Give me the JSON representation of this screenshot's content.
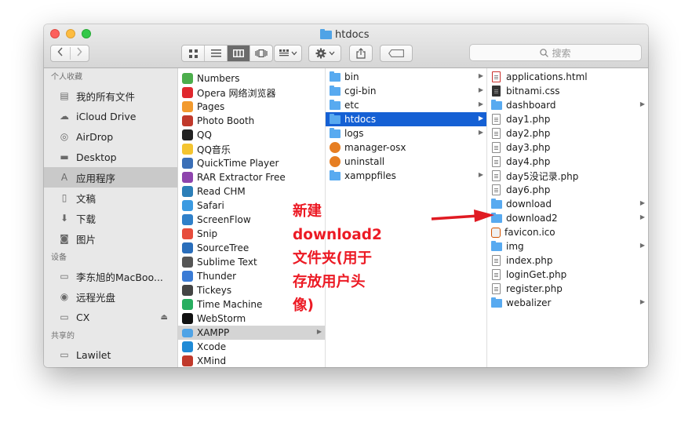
{
  "window": {
    "title": "htdocs"
  },
  "toolbar": {
    "back_icon": "chevron-left-icon",
    "forward_icon": "chevron-right-icon",
    "view_modes": [
      "icon-view",
      "list-view",
      "column-view",
      "cover-flow-view"
    ],
    "active_view": "column-view",
    "search_placeholder": "搜索"
  },
  "sidebar": {
    "sections": [
      {
        "label": "个人收藏",
        "items": [
          {
            "label": "我的所有文件",
            "icon": "all-files-icon"
          },
          {
            "label": "iCloud Drive",
            "icon": "cloud-icon"
          },
          {
            "label": "AirDrop",
            "icon": "airdrop-icon"
          },
          {
            "label": "Desktop",
            "icon": "desktop-icon"
          },
          {
            "label": "应用程序",
            "icon": "applications-icon",
            "selected": true
          },
          {
            "label": "文稿",
            "icon": "documents-icon"
          },
          {
            "label": "下载",
            "icon": "download-icon"
          },
          {
            "label": "图片",
            "icon": "pictures-icon"
          }
        ]
      },
      {
        "label": "设备",
        "items": [
          {
            "label": "李东旭的MacBoo...",
            "icon": "laptop-icon"
          },
          {
            "label": "远程光盘",
            "icon": "disc-icon"
          },
          {
            "label": "CX",
            "icon": "drive-icon",
            "eject": true
          }
        ]
      },
      {
        "label": "共享的",
        "items": [
          {
            "label": "Lawilet",
            "icon": "network-computer-icon"
          }
        ]
      }
    ]
  },
  "columns": {
    "apps": [
      {
        "name": "Numbers",
        "icon": "numbers-app-icon",
        "color": "#4cae4c"
      },
      {
        "name": "Opera 网络浏览器",
        "icon": "opera-icon",
        "color": "#e0282e"
      },
      {
        "name": "Pages",
        "icon": "pages-app-icon",
        "color": "#f29a2e"
      },
      {
        "name": "Photo Booth",
        "icon": "photo-booth-icon",
        "color": "#c0392b"
      },
      {
        "name": "QQ",
        "icon": "qq-icon",
        "color": "#222222"
      },
      {
        "name": "QQ音乐",
        "icon": "qq-music-icon",
        "color": "#f4c430"
      },
      {
        "name": "QuickTime Player",
        "icon": "quicktime-icon",
        "color": "#3a6fb7"
      },
      {
        "name": "RAR Extractor Free",
        "icon": "rar-icon",
        "color": "#8e44ad"
      },
      {
        "name": "Read CHM",
        "icon": "chm-icon",
        "color": "#2c7fb8"
      },
      {
        "name": "Safari",
        "icon": "safari-icon",
        "color": "#3b9ae1"
      },
      {
        "name": "ScreenFlow",
        "icon": "screenflow-icon",
        "color": "#2f80c9"
      },
      {
        "name": "Snip",
        "icon": "snip-icon",
        "color": "#e74c3c"
      },
      {
        "name": "SourceTree",
        "icon": "sourcetree-icon",
        "color": "#2a6ebb"
      },
      {
        "name": "Sublime Text",
        "icon": "sublime-icon",
        "color": "#555555"
      },
      {
        "name": "Thunder",
        "icon": "thunder-icon",
        "color": "#3a7bd5"
      },
      {
        "name": "Tickeys",
        "icon": "tickeys-icon",
        "color": "#444444"
      },
      {
        "name": "Time Machine",
        "icon": "time-machine-icon",
        "color": "#27ae60"
      },
      {
        "name": "WebStorm",
        "icon": "webstorm-icon",
        "color": "#111111"
      },
      {
        "name": "XAMPP",
        "icon": "xampp-icon",
        "color": "#fb7a24",
        "highlight": true
      },
      {
        "name": "Xcode",
        "icon": "xcode-icon",
        "color": "#1f8ad6"
      },
      {
        "name": "XMind",
        "icon": "xmind-icon",
        "color": "#c0392b"
      }
    ],
    "xampp": [
      {
        "name": "bin",
        "type": "folder",
        "chevron": true
      },
      {
        "name": "cgi-bin",
        "type": "folder",
        "chevron": true
      },
      {
        "name": "etc",
        "type": "folder",
        "chevron": true
      },
      {
        "name": "htdocs",
        "type": "folder",
        "chevron": true,
        "selected": true
      },
      {
        "name": "logs",
        "type": "folder",
        "chevron": true
      },
      {
        "name": "manager-osx",
        "type": "app"
      },
      {
        "name": "uninstall",
        "type": "app"
      },
      {
        "name": "xamppfiles",
        "type": "folder",
        "chevron": true
      }
    ],
    "htdocs": [
      {
        "name": "applications.html",
        "type": "html"
      },
      {
        "name": "bitnami.css",
        "type": "css"
      },
      {
        "name": "dashboard",
        "type": "folder",
        "chevron": true
      },
      {
        "name": "day1.php",
        "type": "doc"
      },
      {
        "name": "day2.php",
        "type": "doc"
      },
      {
        "name": "day3.php",
        "type": "doc"
      },
      {
        "name": "day4.php",
        "type": "doc"
      },
      {
        "name": "day5没记录.php",
        "type": "doc"
      },
      {
        "name": "day6.php",
        "type": "doc"
      },
      {
        "name": "download",
        "type": "folder",
        "chevron": true
      },
      {
        "name": "download2",
        "type": "folder",
        "chevron": true
      },
      {
        "name": "favicon.ico",
        "type": "ico"
      },
      {
        "name": "img",
        "type": "folder",
        "chevron": true
      },
      {
        "name": "index.php",
        "type": "doc"
      },
      {
        "name": "loginGet.php",
        "type": "doc"
      },
      {
        "name": "register.php",
        "type": "doc"
      },
      {
        "name": "webalizer",
        "type": "folder",
        "chevron": true
      }
    ]
  },
  "annotation": {
    "lines": [
      "新建",
      "download2",
      "文件夹(用于",
      "存放用户头",
      "像)"
    ],
    "color": "#ec1a24"
  }
}
